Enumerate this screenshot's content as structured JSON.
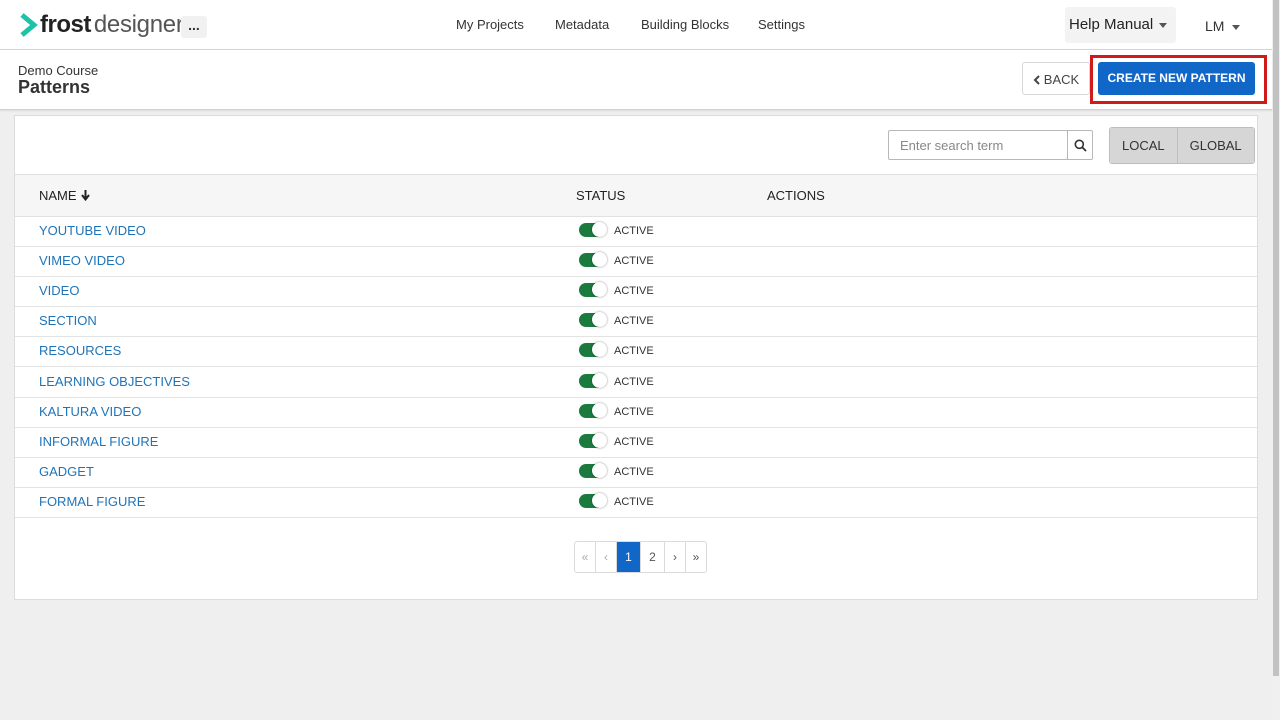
{
  "app": {
    "logo_primary": "frost",
    "logo_secondary": "designer",
    "more_label": "...",
    "nav": [
      "My Projects",
      "Metadata",
      "Building Blocks",
      "Settings"
    ],
    "help_label": "Help Manual",
    "user_initials": "LM"
  },
  "header": {
    "breadcrumb": "Demo Course",
    "title": "Patterns",
    "back_label": "BACK",
    "create_label": "CREATE NEW PATTERN"
  },
  "toolbar": {
    "search_placeholder": "Enter search term",
    "scope": [
      "LOCAL",
      "GLOBAL"
    ]
  },
  "table": {
    "columns": [
      "NAME",
      "STATUS",
      "ACTIONS"
    ],
    "rows": [
      {
        "name": "YOUTUBE VIDEO",
        "status": "ACTIVE"
      },
      {
        "name": "VIMEO VIDEO",
        "status": "ACTIVE"
      },
      {
        "name": "VIDEO",
        "status": "ACTIVE"
      },
      {
        "name": "SECTION",
        "status": "ACTIVE"
      },
      {
        "name": "RESOURCES",
        "status": "ACTIVE"
      },
      {
        "name": "LEARNING OBJECTIVES",
        "status": "ACTIVE"
      },
      {
        "name": "KALTURA VIDEO",
        "status": "ACTIVE"
      },
      {
        "name": "INFORMAL FIGURE",
        "status": "ACTIVE"
      },
      {
        "name": "GADGET",
        "status": "ACTIVE"
      },
      {
        "name": "FORMAL FIGURE",
        "status": "ACTIVE"
      }
    ]
  },
  "pagination": {
    "first": "«",
    "prev": "‹",
    "pages": [
      "1",
      "2"
    ],
    "next": "›",
    "last": "»"
  },
  "colors": {
    "primary": "#1167c8",
    "link": "#1f74b8",
    "toggle_on": "#1b7a3d",
    "highlight": "#d11a1a"
  }
}
